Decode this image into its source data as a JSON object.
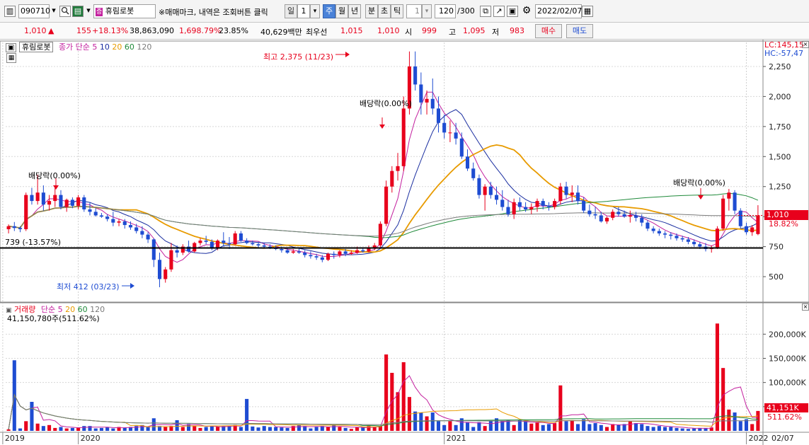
{
  "toolbar": {
    "code": "090710",
    "search_icon": "search-icon",
    "stock_name": "휴림로봇",
    "notice": "※매매마크, 내역은 조회버튼 클릭",
    "periods": [
      "일",
      "주",
      "월",
      "년",
      "분",
      "초",
      "틱"
    ],
    "period_value": "1",
    "tick_value": "1",
    "count": "120",
    "count_total": "/300",
    "date": "2022/02/07"
  },
  "quote": {
    "price": "1,010",
    "arrow": "▲",
    "change": "155",
    "change_pct": "+18.13%",
    "volume": "38,863,090",
    "volume_pct": "1,698.79%",
    "turnover": "23.85%",
    "amount": "40,629백만",
    "priority_label": "최우선",
    "ask": "1,015",
    "bid": "1,010",
    "open_label": "시",
    "open": "999",
    "high_label": "고",
    "high": "1,095",
    "low_label": "저",
    "low": "983",
    "buy_label": "매수",
    "sell_label": "매도"
  },
  "price_panel": {
    "name": "휴림로봇",
    "ma_label": "종가 단순",
    "ma_periods": [
      "5",
      "10",
      "20",
      "60",
      "120"
    ],
    "ma_colors": [
      "#c3209e",
      "#1a2ea0",
      "#e89b00",
      "#1f8a3a",
      "#7a7a7a"
    ],
    "lc_label": "LC:145,15",
    "hc_label": "HC:-57,47",
    "current_price_label": "1,010",
    "current_pct_label": "18.82%",
    "hline_label": "739 (-13.57%)",
    "high_annotation": "최고 2,375 (11/23)",
    "low_annotation": "최저 412 (03/23)",
    "dividend_labels": [
      "배당락(0.00%)",
      "배당락(0.00%)",
      "배당락(0.00%)"
    ]
  },
  "volume_panel": {
    "label": "거래량",
    "ma_label": "단순",
    "ma_periods": [
      "5",
      "20",
      "60",
      "120"
    ],
    "info": "41,150,780주(511.62%)",
    "current_label": "41,151K",
    "current_pct": "511.62%"
  },
  "chart_data": {
    "type": "candlestick",
    "period": "monthly",
    "price_axis": {
      "min": 300,
      "max": 2450,
      "ticks": [
        "2,250",
        "2,000",
        "1,750",
        "1,500",
        "1,250",
        "1,000",
        "750",
        "500"
      ],
      "tick_values": [
        2250,
        2000,
        1750,
        1500,
        1250,
        1000,
        750,
        500
      ]
    },
    "volume_axis": {
      "min": 0,
      "max": 240000,
      "ticks": [
        "200,000K",
        "150,000K",
        "100,000K",
        "50,000K"
      ],
      "tick_values": [
        200000,
        150000,
        100000,
        50000
      ]
    },
    "x_labels": [
      "2019",
      "2020",
      "2021",
      "2022",
      "02/07"
    ],
    "reference_line": 739,
    "candles": [
      [
        895,
        935,
        860,
        920,
        3000
      ],
      [
        920,
        955,
        880,
        905,
        146000
      ],
      [
        905,
        920,
        870,
        895,
        5000
      ],
      [
        895,
        1200,
        880,
        1180,
        20000
      ],
      [
        1180,
        1240,
        1100,
        1130,
        60000
      ],
      [
        1130,
        1350,
        1100,
        1200,
        15000
      ],
      [
        1200,
        1260,
        1050,
        1100,
        10000
      ],
      [
        1100,
        1180,
        1050,
        1130,
        12000
      ],
      [
        1130,
        1240,
        1080,
        1180,
        6000
      ],
      [
        1180,
        1220,
        1060,
        1080,
        8000
      ],
      [
        1080,
        1150,
        1040,
        1140,
        5000
      ],
      [
        1140,
        1160,
        1070,
        1090,
        6000
      ],
      [
        1090,
        1180,
        1060,
        1160,
        7000
      ],
      [
        1160,
        1180,
        1040,
        1060,
        10000
      ],
      [
        1060,
        1120,
        1010,
        1040,
        10000
      ],
      [
        1040,
        1070,
        1000,
        1010,
        5000
      ],
      [
        1010,
        1030,
        990,
        1000,
        6000
      ],
      [
        1000,
        1020,
        960,
        980,
        8000
      ],
      [
        980,
        1040,
        920,
        950,
        5000
      ],
      [
        950,
        980,
        920,
        960,
        8000
      ],
      [
        960,
        980,
        900,
        930,
        6000
      ],
      [
        930,
        960,
        890,
        910,
        8000
      ],
      [
        910,
        940,
        860,
        880,
        10000
      ],
      [
        880,
        920,
        820,
        850,
        12000
      ],
      [
        850,
        870,
        780,
        810,
        8000
      ],
      [
        810,
        820,
        580,
        640,
        26000
      ],
      [
        640,
        700,
        412,
        480,
        10000
      ],
      [
        480,
        580,
        450,
        560,
        8000
      ],
      [
        560,
        780,
        540,
        720,
        10000
      ],
      [
        720,
        760,
        660,
        700,
        22000
      ],
      [
        700,
        770,
        680,
        750,
        8000
      ],
      [
        750,
        800,
        700,
        710,
        14000
      ],
      [
        710,
        790,
        700,
        780,
        11000
      ],
      [
        780,
        820,
        760,
        800,
        6000
      ],
      [
        800,
        840,
        770,
        790,
        8000
      ],
      [
        790,
        810,
        720,
        740,
        10000
      ],
      [
        740,
        810,
        720,
        800,
        8000
      ],
      [
        800,
        870,
        750,
        780,
        10000
      ],
      [
        780,
        830,
        730,
        770,
        11000
      ],
      [
        770,
        880,
        760,
        860,
        12000
      ],
      [
        860,
        880,
        790,
        800,
        8000
      ],
      [
        800,
        820,
        770,
        780,
        66000
      ],
      [
        780,
        800,
        760,
        770,
        9000
      ],
      [
        770,
        790,
        740,
        760,
        7000
      ],
      [
        760,
        780,
        740,
        750,
        10000
      ],
      [
        750,
        770,
        730,
        740,
        8000
      ],
      [
        740,
        760,
        720,
        730,
        8000
      ],
      [
        730,
        750,
        700,
        720,
        7000
      ],
      [
        720,
        740,
        690,
        700,
        6000
      ],
      [
        700,
        730,
        690,
        710,
        10000
      ],
      [
        710,
        740,
        690,
        700,
        12000
      ],
      [
        700,
        720,
        660,
        680,
        10000
      ],
      [
        680,
        710,
        650,
        670,
        5000
      ],
      [
        670,
        690,
        640,
        660,
        8000
      ],
      [
        660,
        680,
        620,
        640,
        10000
      ],
      [
        640,
        700,
        630,
        690,
        8000
      ],
      [
        690,
        710,
        650,
        680,
        12000
      ],
      [
        680,
        720,
        660,
        710,
        8000
      ],
      [
        710,
        730,
        670,
        690,
        6000
      ],
      [
        690,
        720,
        680,
        700,
        4000
      ],
      [
        700,
        750,
        690,
        720,
        8000
      ],
      [
        720,
        740,
        700,
        710,
        8000
      ],
      [
        710,
        760,
        700,
        740,
        10000
      ],
      [
        740,
        780,
        720,
        760,
        8000
      ],
      [
        760,
        960,
        740,
        940,
        10000
      ],
      [
        940,
        1300,
        920,
        1250,
        158000
      ],
      [
        1250,
        1420,
        1200,
        1380,
        120000
      ],
      [
        1380,
        1530,
        1300,
        1420,
        80000
      ],
      [
        1420,
        2000,
        1380,
        1900,
        142000
      ],
      [
        1900,
        2375,
        1850,
        2250,
        70000
      ],
      [
        2250,
        2375,
        2050,
        2100,
        40000
      ],
      [
        2100,
        2200,
        1850,
        1950,
        38000
      ],
      [
        1950,
        2050,
        1850,
        1980,
        30000
      ],
      [
        1980,
        2150,
        1850,
        1900,
        38000
      ],
      [
        1900,
        2000,
        1700,
        1780,
        20000
      ],
      [
        1780,
        1850,
        1650,
        1700,
        12000
      ],
      [
        1700,
        1800,
        1620,
        1700,
        20000
      ],
      [
        1700,
        1780,
        1600,
        1650,
        12000
      ],
      [
        1650,
        1700,
        1480,
        1500,
        26000
      ],
      [
        1500,
        1560,
        1380,
        1400,
        18000
      ],
      [
        1400,
        1450,
        1300,
        1320,
        8000
      ],
      [
        1320,
        1350,
        1150,
        1180,
        18000
      ],
      [
        1180,
        1270,
        1050,
        1250,
        10000
      ],
      [
        1250,
        1290,
        1150,
        1180,
        20000
      ],
      [
        1180,
        1250,
        1100,
        1140,
        26000
      ],
      [
        1140,
        1220,
        1050,
        1080,
        20000
      ],
      [
        1080,
        1140,
        1000,
        1020,
        22000
      ],
      [
        1020,
        1150,
        980,
        1120,
        12000
      ],
      [
        1120,
        1160,
        1050,
        1080,
        22000
      ],
      [
        1080,
        1120,
        1040,
        1060,
        20000
      ],
      [
        1060,
        1110,
        1020,
        1080,
        15000
      ],
      [
        1080,
        1150,
        1040,
        1130,
        18000
      ],
      [
        1130,
        1150,
        1060,
        1090,
        12000
      ],
      [
        1090,
        1120,
        1050,
        1080,
        14000
      ],
      [
        1080,
        1150,
        1060,
        1130,
        16000
      ],
      [
        1130,
        1280,
        1100,
        1250,
        94000
      ],
      [
        1250,
        1290,
        1150,
        1180,
        20000
      ],
      [
        1180,
        1260,
        1120,
        1200,
        22000
      ],
      [
        1200,
        1260,
        1100,
        1130,
        14000
      ],
      [
        1130,
        1160,
        1030,
        1050,
        24000
      ],
      [
        1050,
        1100,
        1000,
        1020,
        14000
      ],
      [
        1020,
        1080,
        980,
        1010,
        16000
      ],
      [
        1010,
        1040,
        950,
        960,
        12000
      ],
      [
        960,
        1000,
        940,
        990,
        8000
      ],
      [
        990,
        1060,
        970,
        1040,
        14000
      ],
      [
        1040,
        1080,
        1000,
        1020,
        12000
      ],
      [
        1020,
        1050,
        990,
        1000,
        14000
      ],
      [
        1000,
        1050,
        950,
        1010,
        20000
      ],
      [
        1010,
        1040,
        960,
        990,
        16000
      ],
      [
        990,
        1020,
        920,
        950,
        14000
      ],
      [
        950,
        970,
        880,
        900,
        10000
      ],
      [
        900,
        920,
        860,
        880,
        8000
      ],
      [
        880,
        900,
        840,
        860,
        10000
      ],
      [
        860,
        880,
        820,
        850,
        8000
      ],
      [
        850,
        870,
        810,
        840,
        8000
      ],
      [
        840,
        860,
        800,
        820,
        6000
      ],
      [
        820,
        840,
        790,
        810,
        5000
      ],
      [
        810,
        830,
        770,
        790,
        4000
      ],
      [
        790,
        810,
        750,
        770,
        5000
      ],
      [
        770,
        790,
        730,
        750,
        6000
      ],
      [
        750,
        780,
        710,
        730,
        6000
      ],
      [
        730,
        760,
        700,
        740,
        7000
      ],
      [
        740,
        920,
        730,
        900,
        222000
      ],
      [
        900,
        1180,
        880,
        1150,
        130000
      ],
      [
        1150,
        1230,
        1050,
        1200,
        44000
      ],
      [
        1200,
        1220,
        1020,
        1050,
        38000
      ],
      [
        1050,
        1070,
        900,
        920,
        20000
      ],
      [
        920,
        950,
        850,
        870,
        24000
      ],
      [
        870,
        930,
        840,
        910,
        14000
      ],
      [
        855,
        1095,
        845,
        1010,
        41151
      ]
    ]
  }
}
